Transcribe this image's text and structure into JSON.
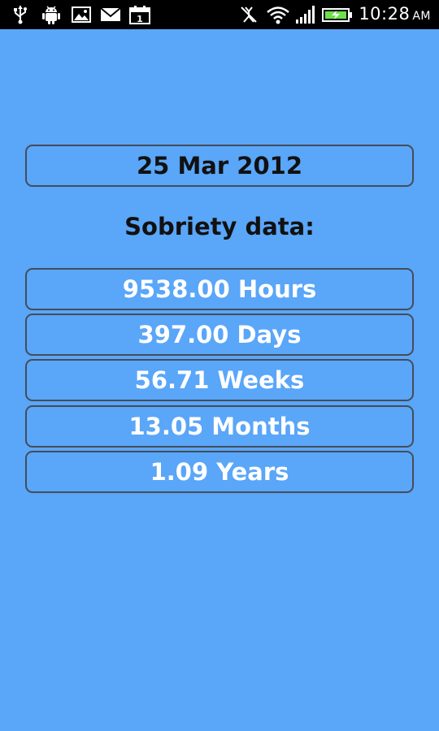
{
  "status_bar": {
    "time": "10:28",
    "ampm": "AM",
    "left_icons": [
      "usb-icon",
      "android-debug-icon",
      "gallery-icon",
      "email-icon",
      "calendar-icon"
    ],
    "calendar_day": "1",
    "right_icons": [
      "vibrate-off-icon",
      "wifi-icon",
      "signal-icon",
      "battery-charging-icon"
    ]
  },
  "date_button": {
    "label": "25 Mar 2012"
  },
  "section": {
    "label": "Sobriety data:"
  },
  "stats": [
    {
      "label": "9538.00 Hours"
    },
    {
      "label": "397.00 Days"
    },
    {
      "label": "56.71 Weeks"
    },
    {
      "label": "13.05 Months"
    },
    {
      "label": "1.09 Years"
    }
  ],
  "colors": {
    "background": "#5aa6f8",
    "box_border": "#444d59",
    "status_bar": "#000000",
    "battery_fill": "#6be04a"
  }
}
